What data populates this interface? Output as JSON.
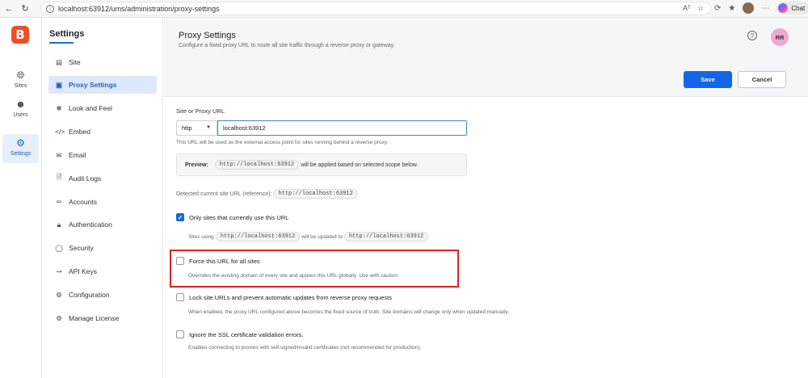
{
  "browser": {
    "url_host": "localhost:63912",
    "url_path": "/ums/administration/proxy-settings",
    "read_aloud": "Aᵀ",
    "chat_label": "Chat"
  },
  "rail": {
    "items": [
      {
        "label": "Sites",
        "icon": "globe-icon"
      },
      {
        "label": "Users",
        "icon": "users-icon"
      },
      {
        "label": "Settings",
        "icon": "gear-icon"
      }
    ]
  },
  "sidebar": {
    "title": "Settings",
    "items": [
      {
        "label": "Site",
        "icon": "list-icon"
      },
      {
        "label": "Proxy Settings",
        "icon": "server-icon"
      },
      {
        "label": "Look and Feel",
        "icon": "palette-icon"
      },
      {
        "label": "Embed",
        "icon": "code-icon"
      },
      {
        "label": "Email",
        "icon": "mail-icon"
      },
      {
        "label": "Audit Logs",
        "icon": "log-icon"
      },
      {
        "label": "Accounts",
        "icon": "accounts-icon"
      },
      {
        "label": "Authentication",
        "icon": "lock-icon"
      },
      {
        "label": "Security",
        "icon": "shield-icon"
      },
      {
        "label": "API Keys",
        "icon": "key-icon"
      },
      {
        "label": "Configuration",
        "icon": "config-icon"
      },
      {
        "label": "Manage License",
        "icon": "license-icon"
      }
    ]
  },
  "header": {
    "title": "Proxy Settings",
    "subtitle": "Configure a fixed proxy URL to route all site traffic through a reverse proxy or gateway.",
    "help": "?",
    "avatar": "RR",
    "save_label": "Save",
    "cancel_label": "Cancel"
  },
  "form": {
    "url_label": "Site or Proxy URL",
    "protocol": "http",
    "url_value": "localhost:63912",
    "url_hint": "This URL will be used as the external access point for sites running behind a reverse proxy.",
    "preview_label": "Preview:",
    "preview_url": "http://localhost:63912",
    "preview_suffix": "will be applied based on selected scope below.",
    "detected_label": "Detected current site URL (reference):",
    "detected_url": "http://localhost:63912",
    "options": [
      {
        "label": "Only sites that currently use this URL",
        "checked": true,
        "hint_prefix": "Sites using",
        "hint_url_a": "http://localhost:63912",
        "hint_middle": "will be updated to",
        "hint_url_b": "http://localhost:63912"
      },
      {
        "label": "Force this URL for all sites",
        "checked": false,
        "hint": "Overrides the existing domain of every site and applies this URL globally. Use with caution."
      },
      {
        "label": "Lock site URLs and prevent automatic updates from reverse proxy requests",
        "checked": false,
        "hint": "When enabled, the proxy URL configured above becomes the fixed source of truth. Site domains will change only when updated manually."
      },
      {
        "label": "Ignore the SSL certificate validation errors.",
        "checked": false,
        "hint": "Enables connecting to proxies with self-signed/invalid certificates (not recommended for production)."
      }
    ]
  },
  "colors": {
    "accent": "#1366e8",
    "logo": "#f04e23",
    "highlight": "#e0201e",
    "active_bg": "#dde9fa"
  }
}
